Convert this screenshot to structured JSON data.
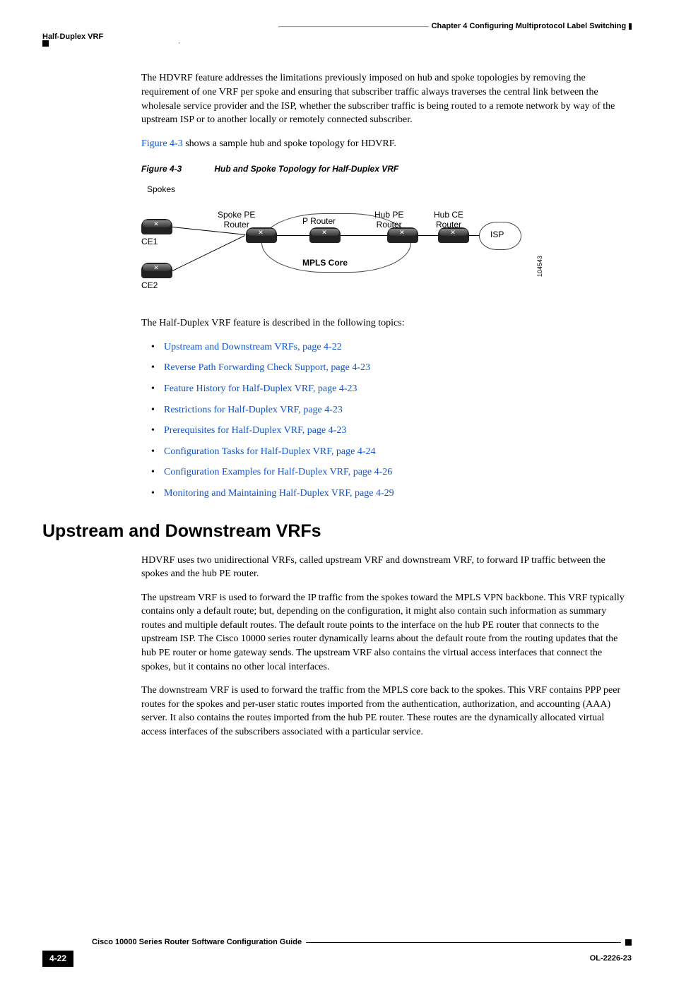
{
  "header": {
    "chapter": "Chapter 4      Configuring Multiprotocol Label Switching",
    "section": "Half-Duplex VRF"
  },
  "body": {
    "para1": "The HDVRF feature addresses the limitations previously imposed on hub and spoke topologies by removing the requirement of one VRF per spoke and ensuring that subscriber traffic always traverses the central link between the wholesale service provider and the ISP, whether the subscriber traffic is being routed to a remote network by way of the upstream ISP or to another locally or remotely connected subscriber.",
    "figref_link": "Figure 4-3",
    "figref_rest": " shows a sample hub and spoke topology for HDVRF.",
    "figure_num": "Figure 4-3",
    "figure_title": "Hub and Spoke Topology for Half-Duplex VRF",
    "intro_topics": "The Half-Duplex VRF feature is described in the following topics:",
    "topics": [
      "Upstream and Downstream VRFs, page 4-22",
      "Reverse Path Forwarding Check Support, page 4-23",
      "Feature History for Half-Duplex VRF, page 4-23",
      "Restrictions for Half-Duplex VRF, page 4-23",
      "Prerequisites for Half-Duplex VRF, page 4-23",
      "Configuration Tasks for Half-Duplex VRF, page 4-24",
      "Configuration Examples for Half-Duplex VRF, page 4-26",
      "Monitoring and Maintaining Half-Duplex VRF, page 4-29"
    ],
    "h2": "Upstream and Downstream VRFs",
    "para2": "HDVRF uses two unidirectional VRFs, called upstream VRF and downstream VRF, to forward IP traffic between the spokes and the hub PE router.",
    "para3": "The upstream VRF is used to forward the IP traffic from the spokes toward the MPLS VPN backbone. This VRF typically contains only a default route; but, depending on the configuration, it might also contain such information as summary routes and multiple default routes. The default route points to the interface on the hub PE router that connects to the upstream ISP. The Cisco 10000 series router dynamically learns about the default route from the routing updates that the hub PE router or home gateway sends. The upstream VRF also contains the virtual access interfaces that connect the spokes, but it contains no other local interfaces.",
    "para4": "The downstream VRF is used to forward the traffic from the MPLS core back to the spokes. This VRF contains PPP peer routes for the spokes and per-user static routes imported from the authentication, authorization, and accounting (AAA) server. It also contains the routes imported from the hub PE router. These routes are the dynamically allocated virtual access interfaces of the subscribers associated with a particular service."
  },
  "diagram": {
    "spokes": "Spokes",
    "ce1": "CE1",
    "ce2": "CE2",
    "spoke_pe": "Spoke PE\nRouter",
    "p_router": "P Router",
    "hub_pe": "Hub PE\nRouter",
    "hub_ce": "Hub CE\nRouter",
    "isp": "ISP",
    "mpls_core": "MPLS Core",
    "figid": "104543"
  },
  "footer": {
    "guide": "Cisco 10000 Series Router Software Configuration Guide",
    "page": "4-22",
    "doc": "OL-2226-23"
  }
}
